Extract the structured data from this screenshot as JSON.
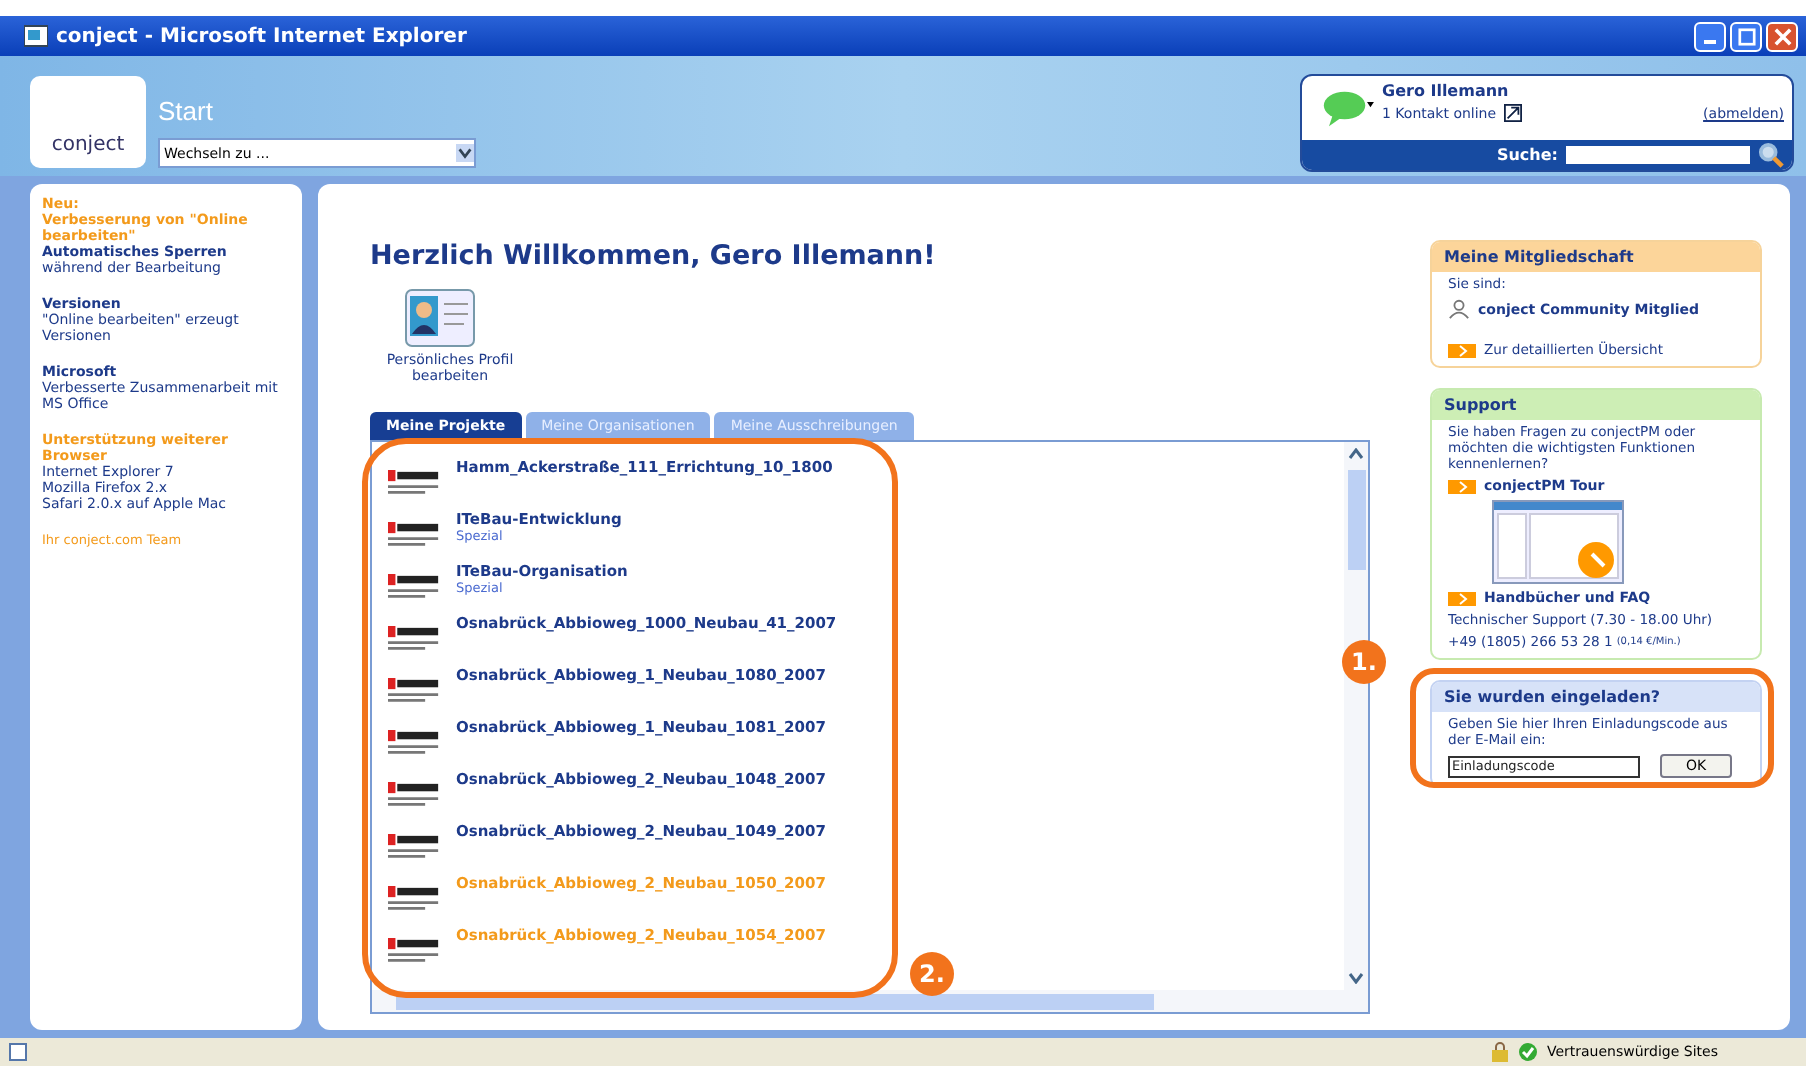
{
  "window": {
    "title": "conject - Microsoft Internet Explorer"
  },
  "header": {
    "logo": "conject",
    "page_title": "Start",
    "switch_to": {
      "value": "Wechseln zu ..."
    },
    "user": {
      "name": "Gero Illemann",
      "contacts": "1 Kontakt online",
      "logout": "(abmelden)",
      "search_label": "Suche:"
    }
  },
  "news": [
    {
      "kind": "heading",
      "text": "Neu:"
    },
    {
      "kind": "heading",
      "text": "Verbesserung von \"Online bearbeiten\""
    },
    {
      "kind": "title",
      "text": "Automatisches Sperren"
    },
    {
      "kind": "body",
      "text": "während der Bearbeitung"
    },
    {
      "kind": "title",
      "text": "Versionen",
      "gap": true
    },
    {
      "kind": "body",
      "text": "\"Online bearbeiten\" erzeugt Versionen"
    },
    {
      "kind": "title",
      "text": "Microsoft",
      "gap": true
    },
    {
      "kind": "body",
      "text": "Verbesserte Zusammenarbeit mit MS Office"
    },
    {
      "kind": "heading",
      "text": "Unterstützung weiterer Browser",
      "gap": true
    },
    {
      "kind": "body",
      "text": "Internet Explorer 7"
    },
    {
      "kind": "body",
      "text": "Mozilla Firefox 2.x"
    },
    {
      "kind": "body",
      "text": "Safari 2.0.x auf Apple Mac"
    },
    {
      "kind": "signature",
      "text": "Ihr conject.com Team",
      "gap": true
    }
  ],
  "welcome": "Herzlich Willkommen, Gero Illemann!",
  "profile_link": "Persönliches Profil bearbeiten",
  "tabs": [
    {
      "label": "Meine Projekte",
      "selected": true
    },
    {
      "label": "Meine Organisationen",
      "selected": false
    },
    {
      "label": "Meine Ausschreibungen",
      "selected": false
    }
  ],
  "projects": [
    {
      "name": "Hamm_Ackerstraße_111_Errichtung_10_1800",
      "visited": false
    },
    {
      "name": "ITeBau-Entwicklung",
      "subtitle": "Spezial",
      "visited": false
    },
    {
      "name": "ITeBau-Organisation",
      "subtitle": "Spezial",
      "visited": false
    },
    {
      "name": "Osnabrück_Abbioweg_1000_Neubau_41_2007",
      "visited": false
    },
    {
      "name": "Osnabrück_Abbioweg_1_Neubau_1080_2007",
      "visited": false
    },
    {
      "name": "Osnabrück_Abbioweg_1_Neubau_1081_2007",
      "visited": false
    },
    {
      "name": "Osnabrück_Abbioweg_2_Neubau_1048_2007",
      "visited": false
    },
    {
      "name": "Osnabrück_Abbioweg_2_Neubau_1049_2007",
      "visited": false
    },
    {
      "name": "Osnabrück_Abbioweg_2_Neubau_1050_2007",
      "visited": true
    },
    {
      "name": "Osnabrück_Abbioweg_2_Neubau_1054_2007",
      "visited": true
    }
  ],
  "membership": {
    "title": "Meine Mitgliedschaft",
    "intro": "Sie sind:",
    "status": "conject Community Mitglied",
    "link": "Zur detaillierten Übersicht"
  },
  "support": {
    "title": "Support",
    "text": "Sie haben Fragen zu conjectPM oder möchten die wichtigsten Funktionen kennenlernen?",
    "tour": "conjectPM Tour",
    "manuals": "Handbücher und FAQ",
    "hotline": "Technischer Support (7.30 - 18.00 Uhr)",
    "phone": "+49 (1805) 266 53 28 1",
    "note": "(0,14 €/Min.)"
  },
  "invitation": {
    "title": "Sie wurden eingeladen?",
    "text": "Geben Sie hier Ihren Einladungscode aus der E-Mail ein:",
    "code": {
      "placeholder": "Einladungscode"
    },
    "button": "OK"
  },
  "annotations": [
    {
      "label": "1."
    },
    {
      "label": "2."
    }
  ],
  "status_bar": {
    "zone": "Vertrauenswürdige Sites"
  }
}
